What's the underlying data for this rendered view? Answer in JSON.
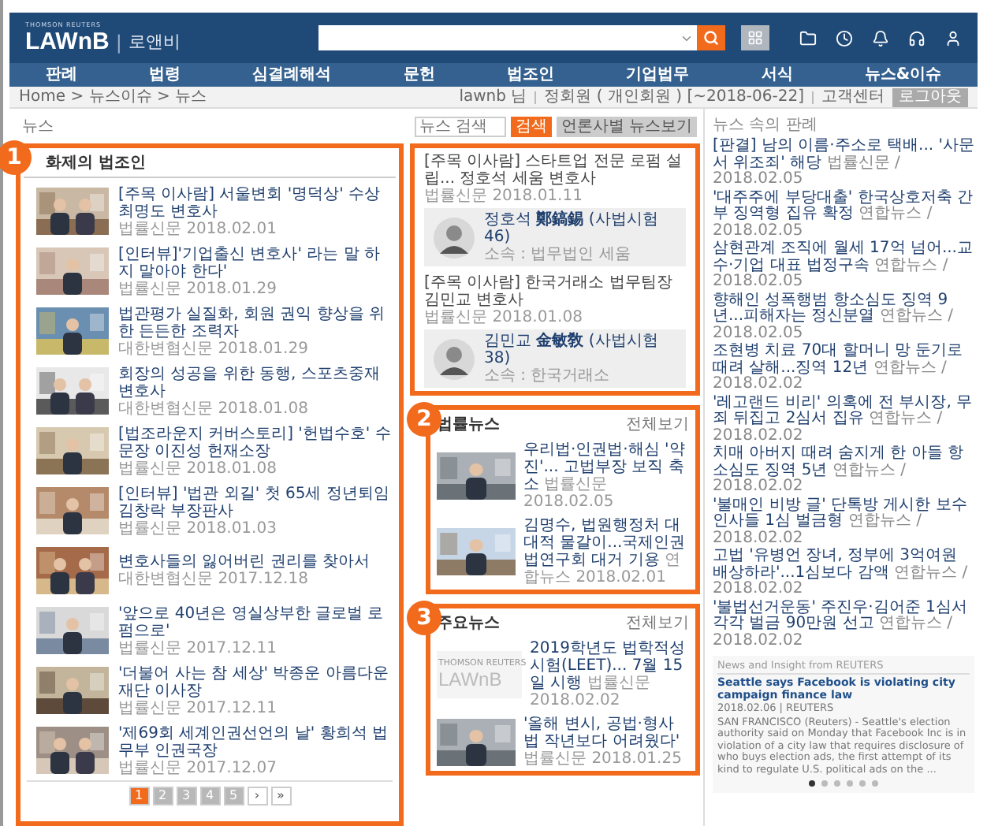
{
  "header": {
    "logo_small": "THOMSON REUTERS",
    "logo": "LAWnB",
    "logo_divider": "|",
    "logo_korean": "로앤비"
  },
  "nav": [
    "판례",
    "법령",
    "심결례해석",
    "문헌",
    "법조인",
    "기업법무",
    "서식",
    "뉴스&이슈"
  ],
  "breadcrumb": "Home > 뉴스이슈 > 뉴스",
  "user_bar": {
    "user": "lawnb 님",
    "membership": "정회원 ( 개인회원 ) [~2018-06-22]",
    "support": "고객센터",
    "logout": "로그아웃"
  },
  "page_title": "뉴스",
  "news_search": {
    "placeholder": "뉴스 검색",
    "button": "검색",
    "press_button": "언론사별 뉴스보기"
  },
  "people": {
    "title": "화제의 법조인",
    "highlighted": true,
    "callout": "1",
    "items": [
      {
        "title": "[주목 이사람] 서울변회 '명덕상' 수상 최명도 변호사",
        "source": "법률신문",
        "date": "2018.02.01"
      },
      {
        "title": "[인터뷰]'기업출신 변호사' 라는 말 하지 말아야 한다'",
        "source": "법률신문",
        "date": "2018.01.29"
      },
      {
        "title": "법관평가 실질화, 회원 권익 향상을 위한 든든한 조력자",
        "source": "대한변협신문",
        "date": "2018.01.29"
      },
      {
        "title": "회장의 성공을 위한 동행, 스포츠중재변호사",
        "source": "대한변협신문",
        "date": "2018.01.08"
      },
      {
        "title": "[법조라운지 커버스토리] '헌법수호' 수문장 이진성 헌재소장",
        "source": "법률신문",
        "date": "2018.01.08"
      },
      {
        "title": "[인터뷰] '법관 외길' 첫 65세 정년퇴임 김창락 부장판사",
        "source": "법률신문",
        "date": "2018.01.03"
      },
      {
        "title": "변호사들의 잃어버린 권리를 찾아서",
        "source": "대한변협신문",
        "date": "2017.12.18"
      },
      {
        "title": "'앞으로 40년은 영실상부한 글로벌 로펌으로'",
        "source": "법률신문",
        "date": "2017.12.11"
      },
      {
        "title": "'더불어 사는 참 세상' 박종운 아름다운재단 이사장",
        "source": "법률신문",
        "date": "2017.12.11"
      },
      {
        "title": "'제69회 세계인권선언의 날' 황희석 법무부 인권국장",
        "source": "법률신문",
        "date": "2017.12.07"
      }
    ],
    "pagination": [
      {
        "label": "1",
        "selected": true
      },
      {
        "label": "2",
        "selected": false
      },
      {
        "label": "3",
        "selected": false
      },
      {
        "label": "4",
        "selected": false
      },
      {
        "label": "5",
        "selected": false
      },
      {
        "label": "›",
        "selected": false
      },
      {
        "label": "»",
        "selected": false
      }
    ]
  },
  "featured": {
    "highlighted": true,
    "items": [
      {
        "title": "[주목 이사람] 스타트업 전문 로펌 설립... 정호석 세움 변호사",
        "source": "법률신문",
        "date": "2018.01.11",
        "person": {
          "name": "정호석 **鄭鎬錫** (사법시험 46)",
          "affiliation": "소속 : 법무법인 세움"
        }
      },
      {
        "title": "[주목 이사람] 한국거래소 법무팀장 김민교 변호사",
        "source": "법률신문",
        "date": "2018.01.08",
        "person": {
          "name": "김민교 **金敏敎** (사법시험 38)",
          "affiliation": "소속 : 한국거래소"
        }
      }
    ]
  },
  "legal_news": {
    "title": "법률뉴스",
    "more": "전체보기",
    "highlighted": true,
    "callout": "2",
    "items": [
      {
        "title": "우리법·인권법·해심 '약진'... 고법부장 보직 축소",
        "source": "법률신문",
        "date": "2018.02.05"
      },
      {
        "title": "김명수, 법원행정처 대대적 물갈이...국제인권법연구회 대거 기용",
        "source": "연합뉴스",
        "date": "2018.02.01"
      }
    ]
  },
  "main_news": {
    "title": "주요뉴스",
    "more": "전체보기",
    "highlighted": true,
    "callout": "3",
    "items": [
      {
        "kind": "logo",
        "logo_small": "THOMSON REUTERS",
        "logo": "LAWnB",
        "title": "2019학년도 법학적성시험(LEET)... 7월 15일 시행",
        "source": "법률신문",
        "date": "2018.02.02"
      },
      {
        "title": "'올해 변시, 공법·형사법 작년보다 어려웠다'",
        "source": "법률신문",
        "date": "2018.01.25"
      }
    ]
  },
  "case_news": {
    "title": "뉴스 속의 판례",
    "items": [
      {
        "title": "[판결] 남의 이름·주소로 택배... '사문서 위조죄' 해당",
        "meta": "법률신문 / 2018.02.05"
      },
      {
        "title": "'대주주에 부당대출' 한국상호저축 간부 징역형 집유 확정",
        "meta": "연합뉴스 / 2018.02.05"
      },
      {
        "title": "삼현관계 조직에 월세 17억 넘어...교수·기업 대표 법정구속",
        "meta": "연합뉴스 / 2018.02.05"
      },
      {
        "title": "향해인 성폭행범 항소심도 징역 9년...피해자는 정신분열",
        "meta": "연합뉴스 / 2018.02.05"
      },
      {
        "title": "조현병 치료 70대 할머니 망 둔기로 때려 살해...징역 12년",
        "meta": "연합뉴스 / 2018.02.02"
      },
      {
        "title": "'레고랜드 비리' 의혹에 전 부시장, 무죄 뒤집고 2심서 집유",
        "meta": "연합뉴스 / 2018.02.02"
      },
      {
        "title": "치매 아버지 때려 숨지게 한 아들 항소심도 징역 5년",
        "meta": "연합뉴스 / 2018.02.02"
      },
      {
        "title": "'불매인 비방 글' 단톡방 게시한 보수 인사들 1심 벌금형",
        "meta": "연합뉴스 / 2018.02.02"
      },
      {
        "title": "고법 '유병언 장녀, 정부에 3억여원 배상하라'...1심보다 감액",
        "meta": "연합뉴스 / 2018.02.02"
      },
      {
        "title": "'불법선거운동' 주진우·김어준 1심서 각각 벌금 90만원 선고",
        "meta": "연합뉴스 / 2018.02.02"
      }
    ]
  },
  "reuters": {
    "title": "News and Insight from REUTERS",
    "headline": "Seattle says Facebook is violating city campaign finance law",
    "meta": "2018.02.06 | REUTERS",
    "summary": "SAN FRANCISCO (Reuters) - Seattle's election authority said on Monday that Facebook Inc is in violation of a city law that requires disclosure of who buys election ads, the first attempt of its kind to regulate U.S. political ads on the ...",
    "dots": [
      {
        "selected": true
      },
      {
        "selected": false
      },
      {
        "selected": false
      },
      {
        "selected": false
      },
      {
        "selected": false
      },
      {
        "selected": false
      }
    ]
  }
}
